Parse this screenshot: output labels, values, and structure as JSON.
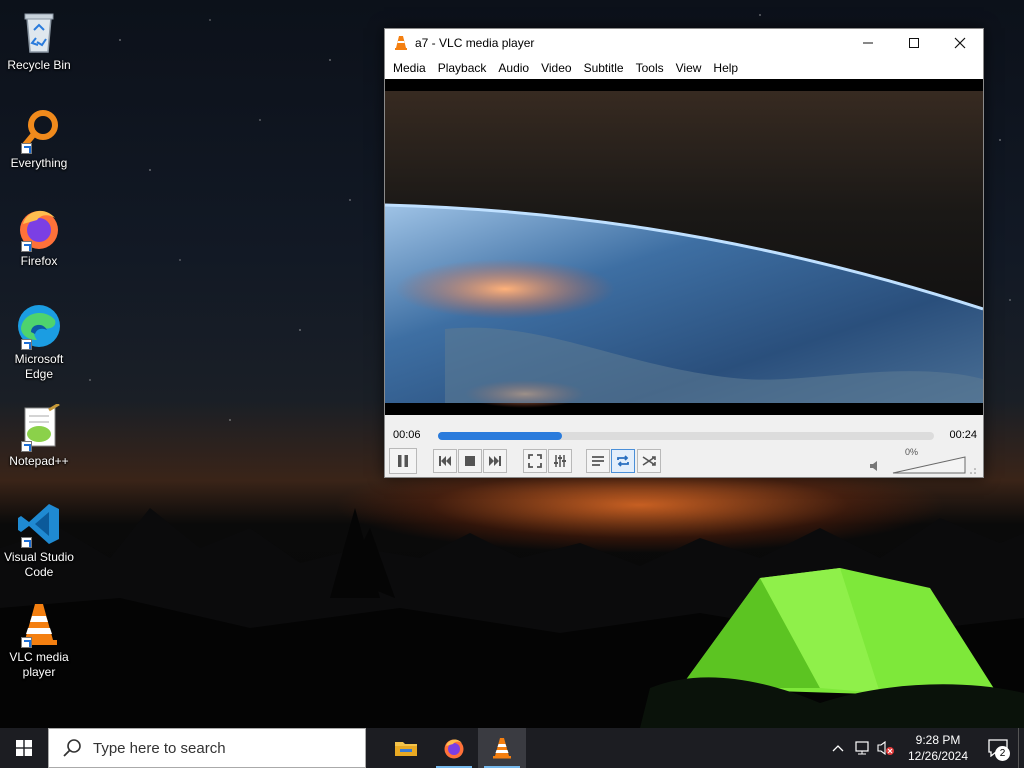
{
  "desktop": {
    "icons": [
      {
        "label": "Recycle Bin",
        "icon": "recycle-bin-icon"
      },
      {
        "label": "Everything",
        "icon": "everything-search-icon"
      },
      {
        "label": "Firefox",
        "icon": "firefox-icon"
      },
      {
        "label": "Microsoft Edge",
        "icon": "edge-icon"
      },
      {
        "label": "Notepad++",
        "icon": "notepadpp-icon"
      },
      {
        "label": "Visual Studio Code",
        "icon": "vscode-icon"
      },
      {
        "label": "VLC media player",
        "icon": "vlc-icon"
      }
    ]
  },
  "vlc": {
    "title": "a7 - VLC media player",
    "menu": [
      "Media",
      "Playback",
      "Audio",
      "Video",
      "Subtitle",
      "Tools",
      "View",
      "Help"
    ],
    "time_current": "00:06",
    "time_total": "00:24",
    "progress_fraction": 0.25,
    "volume_label": "0%",
    "volume_fraction": 0,
    "repeat_active": true,
    "accent_color": "#2a7bdc"
  },
  "taskbar": {
    "search_placeholder": "Type here to search",
    "apps": [
      "file-explorer-icon",
      "firefox-icon",
      "vlc-icon"
    ],
    "active_app": "vlc-icon",
    "time": "9:28 PM",
    "date": "12/26/2024",
    "notification_count": "2"
  }
}
